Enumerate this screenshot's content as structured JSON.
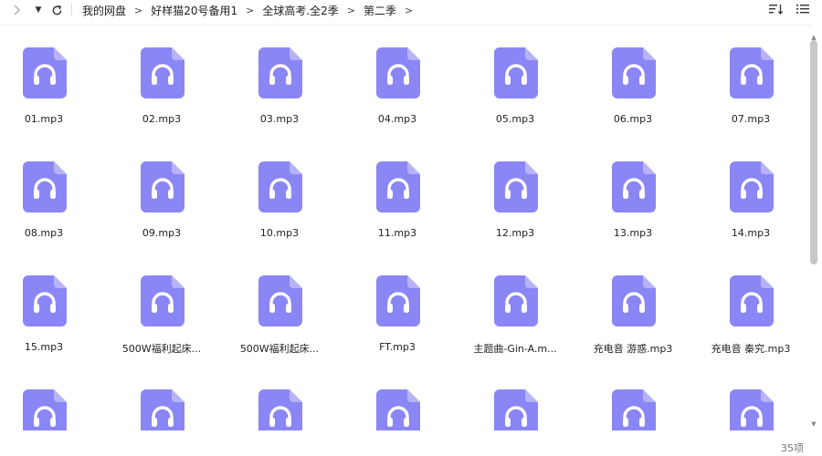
{
  "toolbar": {
    "breadcrumb": [
      "我的网盘",
      "好样猫20号备用1",
      "全球高考.全2季",
      "第二季"
    ],
    "separator": ">",
    "icons": [
      "back-icon",
      "forward-icon",
      "history-dropdown-icon",
      "refresh-icon",
      "sort-icon",
      "list-view-icon"
    ]
  },
  "files": [
    {
      "name": "01.mp3"
    },
    {
      "name": "02.mp3"
    },
    {
      "name": "03.mp3"
    },
    {
      "name": "04.mp3"
    },
    {
      "name": "05.mp3"
    },
    {
      "name": "06.mp3"
    },
    {
      "name": "07.mp3"
    },
    {
      "name": "08.mp3"
    },
    {
      "name": "09.mp3"
    },
    {
      "name": "10.mp3"
    },
    {
      "name": "11.mp3"
    },
    {
      "name": "12.mp3"
    },
    {
      "name": "13.mp3"
    },
    {
      "name": "14.mp3"
    },
    {
      "name": "15.mp3"
    },
    {
      "name": "500W福利起床..."
    },
    {
      "name": "500W福利起床..."
    },
    {
      "name": "FT.mp3"
    },
    {
      "name": "主题曲-Gin-A.m..."
    },
    {
      "name": "充电音 游惑.mp3"
    },
    {
      "name": "充电音 秦究.mp3"
    },
    {
      "name": ""
    },
    {
      "name": ""
    },
    {
      "name": ""
    },
    {
      "name": ""
    },
    {
      "name": ""
    },
    {
      "name": ""
    },
    {
      "name": ""
    }
  ],
  "file_icon": {
    "type": "headphones-icon",
    "color": "#8b86f5",
    "fold_color": "#b7b3fa"
  },
  "status": {
    "count": "35项"
  }
}
